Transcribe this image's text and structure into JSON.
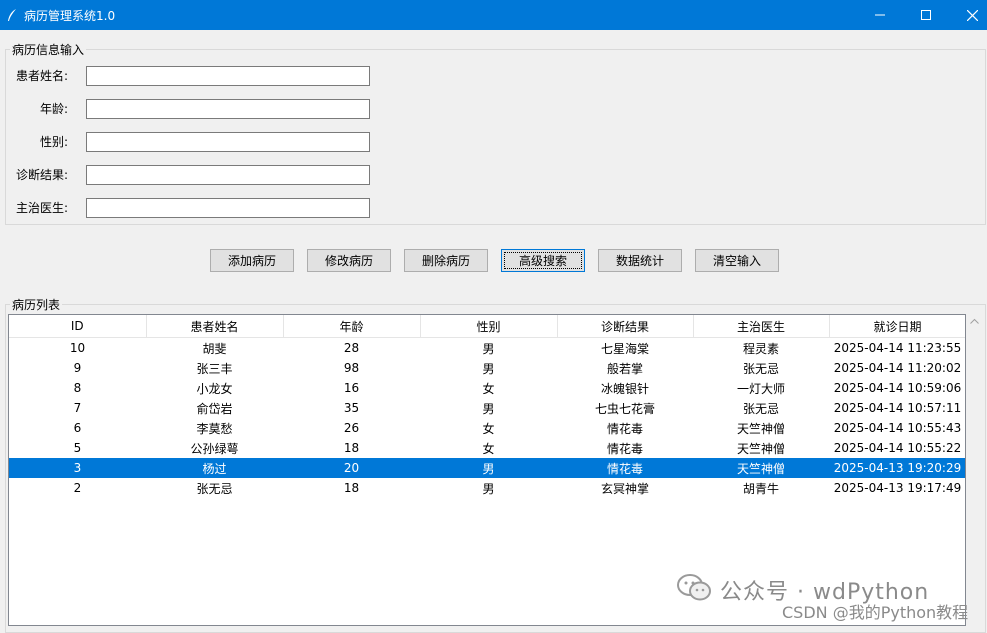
{
  "window": {
    "title": "病历管理系统1.0",
    "icon": "feather-icon",
    "accent_color": "#0078d7"
  },
  "input_group": {
    "legend": "病历信息输入",
    "fields": [
      {
        "label": "患者姓名:",
        "value": "",
        "placeholder": ""
      },
      {
        "label": "年龄:",
        "value": "",
        "placeholder": ""
      },
      {
        "label": "性别:",
        "value": "",
        "placeholder": ""
      },
      {
        "label": "诊断结果:",
        "value": "",
        "placeholder": ""
      },
      {
        "label": "主治医生:",
        "value": "",
        "placeholder": ""
      }
    ]
  },
  "buttons": [
    "添加病历",
    "修改病历",
    "删除病历",
    "高级搜索",
    "数据统计",
    "清空输入"
  ],
  "focused_button": "高级搜索",
  "list_group": {
    "legend": "病历列表",
    "columns": [
      "ID",
      "患者姓名",
      "年龄",
      "性别",
      "诊断结果",
      "主治医生",
      "就诊日期"
    ],
    "rows": [
      [
        "10",
        "胡斐",
        "28",
        "男",
        "七星海棠",
        "程灵素",
        "2025-04-14 11:23:55"
      ],
      [
        "9",
        "张三丰",
        "98",
        "男",
        "般若掌",
        "张无忌",
        "2025-04-14 11:20:02"
      ],
      [
        "8",
        "小龙女",
        "16",
        "女",
        "冰魄银针",
        "一灯大师",
        "2025-04-14 10:59:06"
      ],
      [
        "7",
        "俞岱岩",
        "35",
        "男",
        "七虫七花膏",
        "张无忌",
        "2025-04-14 10:57:11"
      ],
      [
        "6",
        "李莫愁",
        "26",
        "女",
        "情花毒",
        "天竺神僧",
        "2025-04-14 10:55:43"
      ],
      [
        "5",
        "公孙绿萼",
        "18",
        "女",
        "情花毒",
        "天竺神僧",
        "2025-04-14 10:55:22"
      ],
      [
        "3",
        "杨过",
        "20",
        "男",
        "情花毒",
        "天竺神僧",
        "2025-04-13 19:20:29"
      ],
      [
        "2",
        "张无忌",
        "18",
        "男",
        "玄冥神掌",
        "胡青牛",
        "2025-04-13 19:17:49"
      ]
    ],
    "selected_row": 6,
    "selection_color": "#0078d7"
  },
  "watermark": {
    "wechat": "公众号 · wdPython",
    "csdn": "CSDN @我的Python教程"
  }
}
